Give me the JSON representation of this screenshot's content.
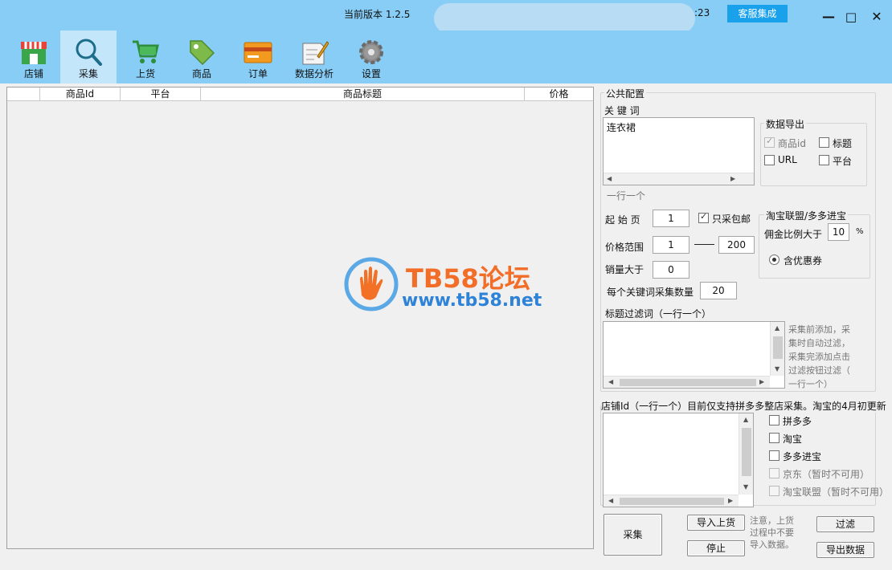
{
  "window": {
    "version": "当前版本  1.2.5",
    "time": ":23",
    "service_button": "客服集成",
    "minimize": "—",
    "maximize": "□",
    "close": "✕"
  },
  "nav": {
    "items": [
      {
        "label": "店铺",
        "icon": "shop-icon"
      },
      {
        "label": "采集",
        "icon": "search-icon"
      },
      {
        "label": "上货",
        "icon": "cart-icon"
      },
      {
        "label": "商品",
        "icon": "tag-icon"
      },
      {
        "label": "订单",
        "icon": "card-icon"
      },
      {
        "label": "数据分析",
        "icon": "chart-icon"
      },
      {
        "label": "设置",
        "icon": "gear-icon"
      }
    ],
    "active_index": 1
  },
  "table": {
    "columns": [
      "",
      "商品Id",
      "平台",
      "商品标题",
      "价格"
    ]
  },
  "watermark": {
    "title": "TB58论坛",
    "url": "www.tb58.net"
  },
  "config": {
    "group_title": "公共配置",
    "keywords_label": "关 键 词",
    "keywords_value": "连衣裙",
    "keywords_hint": "一行一个",
    "export": {
      "title": "数据导出",
      "items": [
        {
          "label": "商品id",
          "checked": true,
          "disabled": true
        },
        {
          "label": "标题",
          "checked": false
        },
        {
          "label": "URL",
          "checked": false
        },
        {
          "label": "平台",
          "checked": false
        }
      ]
    },
    "start_page_label": "起 始 页",
    "start_page": "1",
    "free_shipping_label": "只采包邮",
    "price_range_label": "价格范围",
    "price_min": "1",
    "price_max": "200",
    "sales_label": "销量大于",
    "sales_value": "0",
    "per_keyword_label": "每个关键词采集数量",
    "per_keyword_value": "20",
    "union": {
      "title": "淘宝联盟/多多进宝",
      "commission_label": "佣金比例大于",
      "commission_value": "10",
      "percent": "%",
      "coupon_label": "含优惠券"
    },
    "title_filter_label": "标题过滤词（一行一个）",
    "title_filter_note": [
      "采集前添加，采",
      "集时自动过滤，",
      "采集完添加点击",
      "过滤按钮过滤（",
      "一行一个）"
    ]
  },
  "shop": {
    "label": "店铺Id（一行一个）目前仅支持拼多多整店采集。淘宝的4月初更新",
    "platforms": [
      {
        "label": "拼多多",
        "disabled": false
      },
      {
        "label": "淘宝",
        "disabled": false
      },
      {
        "label": "多多进宝",
        "disabled": false
      },
      {
        "label": "京东（暂时不可用）",
        "disabled": true
      },
      {
        "label": "淘宝联盟（暂时不可用）",
        "disabled": true
      }
    ]
  },
  "actions": {
    "collect": "采集",
    "import": "导入上货",
    "stop": "停止",
    "note": [
      "注意，上货",
      "过程中不要",
      "导入数据。"
    ],
    "filter": "过滤",
    "export": "导出数据"
  }
}
